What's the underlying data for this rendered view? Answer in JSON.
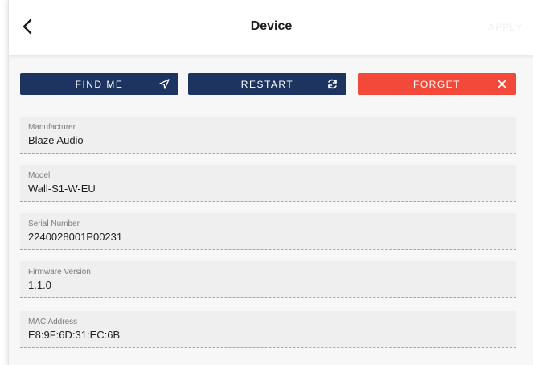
{
  "header": {
    "title": "Device",
    "back_icon": "chevron-left-icon",
    "action_label": "APPLY"
  },
  "actions": {
    "find_me": {
      "label": "FIND ME",
      "icon": "navigation-arrow-icon",
      "color": "#1d3461"
    },
    "restart": {
      "label": "RESTART",
      "icon": "refresh-icon",
      "color": "#1d3461"
    },
    "forget": {
      "label": "FORGET",
      "icon": "close-icon",
      "color": "#f2493b"
    }
  },
  "fields": [
    {
      "label": "Manufacturer",
      "value": "Blaze Audio"
    },
    {
      "label": "Model",
      "value": "Wall-S1-W-EU"
    },
    {
      "label": "Serial Number",
      "value": "2240028001P00231"
    },
    {
      "label": "Firmware Version",
      "value": "1.1.0"
    },
    {
      "label": "MAC Address",
      "value": "E8:9F:6D:31:EC:6B"
    }
  ]
}
